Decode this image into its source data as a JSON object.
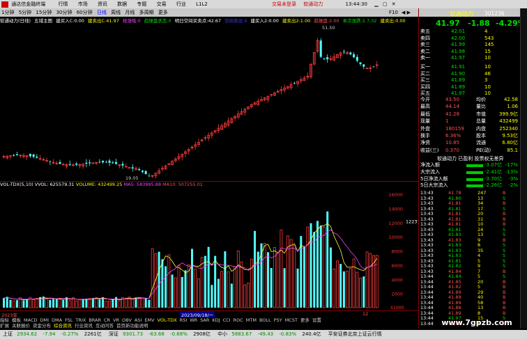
{
  "window": {
    "title": "通达信金融终端"
  },
  "menu": [
    "行情",
    "市场",
    "资讯",
    "数据",
    "专题",
    "交易",
    "行业",
    "L1L2"
  ],
  "menu_right": {
    "promo": "交易未登录",
    "stock": "软通动力",
    "time": "13:44:30"
  },
  "toolbar": {
    "timeframes": [
      "1分钟",
      "5分钟",
      "15分钟",
      "30分钟",
      "60分钟",
      "日线",
      "周线",
      "月线",
      "多周期",
      "更多"
    ],
    "active": "日线"
  },
  "chartinfo": {
    "name": "软通动力(日线)",
    "mode": "五域主图",
    "b1": "建买入C:0.00",
    "b2": "建卖出C:41.97",
    "b3": "抢涨吸:0",
    "b4": "趋操盘状态:0",
    "b5": "明日空间买卖点:42.67",
    "b6": "空间卖出:0",
    "b7": "建买入2:0.00",
    "b8": "建卖出2:1.00",
    "b9": "趋操盘:2.00",
    "b10": "本次涨跌:2.7.32",
    "b11": "建卖出:0.00"
  },
  "main_chart": {
    "price_axis": [
      "50.00",
      "47.50",
      "45.00",
      "42.50",
      "40.00",
      "37.50",
      "35.00",
      "32.50",
      "30.00",
      "27.50",
      "25.00",
      "22.50"
    ],
    "high_label": "51.50",
    "low_label": "19.05"
  },
  "volume_chart": {
    "indicator": "VOL-TDX(5,10)",
    "vvol": "VVOL: 625579.31",
    "volume": "VOLUME: 432499.25",
    "ma5": "MA5: 583995.88",
    "ma10": "MA10: 507255.01",
    "axis": [
      "16000",
      "14000",
      "12000",
      "10000",
      "8000",
      "6000",
      "4000",
      "2000"
    ],
    "marker": "12231",
    "xunit": "X1000"
  },
  "xaxis": {
    "left": "2023年",
    "date": "2023/09/18/一",
    "month": "12"
  },
  "quote": {
    "name": "软通动力",
    "code": "301236",
    "price": "41.97",
    "change": "-1.88",
    "pct": "-4.29%",
    "asks": [
      {
        "l": "卖五",
        "p": "42.01",
        "v": "4"
      },
      {
        "l": "卖四",
        "p": "42.00",
        "v": "543"
      },
      {
        "l": "卖三",
        "p": "41.99",
        "v": "145"
      },
      {
        "l": "卖二",
        "p": "41.98",
        "v": "15"
      },
      {
        "l": "卖一",
        "p": "41.97",
        "v": "10"
      }
    ],
    "bids": [
      {
        "l": "买一",
        "p": "41.91",
        "v": "10"
      },
      {
        "l": "买二",
        "p": "41.90",
        "v": "46"
      },
      {
        "l": "买三",
        "p": "41.89",
        "v": "3"
      },
      {
        "l": "买四",
        "p": "41.89",
        "v": "10"
      },
      {
        "l": "买五",
        "p": "41.97",
        "v": "10"
      }
    ],
    "stats": [
      {
        "a": "今开",
        "b": "43.50",
        "c": "均价",
        "d": "42.58"
      },
      {
        "a": "最高",
        "b": "44.14",
        "c": "量比",
        "d": "1.06"
      },
      {
        "a": "最低",
        "b": "41.28",
        "c": "市值",
        "d": "399.9亿"
      },
      {
        "a": "现量",
        "b": "1",
        "c": "总量",
        "d": "432499"
      },
      {
        "a": "外盘",
        "b": "180159",
        "c": "内盘",
        "d": "252340"
      },
      {
        "a": "换手",
        "b": "6.36%",
        "c": "股本",
        "d": "9.53亿"
      },
      {
        "a": "净资",
        "b": "10.85",
        "c": "流通",
        "d": "6.80亿"
      },
      {
        "a": "收益(三)",
        "b": "0.370",
        "c": "PE(动)",
        "d": "85.1"
      }
    ],
    "fundtitle": "软通动力 已盈利 投票权无差异",
    "funds": [
      {
        "n": "净流入额",
        "v": "-3.07亿",
        "p": "-17%"
      },
      {
        "n": "大宗流入",
        "v": "-2.41亿",
        "p": "-13%"
      },
      {
        "n": "5日净流入额",
        "v": "-3.70亿",
        "p": "-3%"
      },
      {
        "n": "5日大宗流入",
        "v": "-2.26亿",
        "p": "-2%"
      }
    ],
    "ticks": [
      [
        "13:43",
        "41.78",
        "247",
        "B"
      ],
      [
        "13:43",
        "41.80",
        "13",
        "S"
      ],
      [
        "13:43",
        "41.81",
        "34",
        "B"
      ],
      [
        "13:43",
        "41.81",
        "17",
        "S"
      ],
      [
        "13:43",
        "41.81",
        "20",
        "B"
      ],
      [
        "13:43",
        "41.81",
        "31",
        "B"
      ],
      [
        "13:43",
        "41.81",
        "10",
        "B"
      ],
      [
        "13:43",
        "41.81",
        "24",
        "S"
      ],
      [
        "13:43",
        "41.83",
        "13",
        "S"
      ],
      [
        "13:43",
        "41.83",
        "9",
        "B"
      ],
      [
        "13:43",
        "41.83",
        "8",
        "S"
      ],
      [
        "13:43",
        "41.83",
        "35",
        "S"
      ],
      [
        "13:43",
        "41.83",
        "4",
        "S"
      ],
      [
        "13:43",
        "41.81",
        "5",
        "S"
      ],
      [
        "13:43",
        "41.82",
        "9",
        "S"
      ],
      [
        "13:43",
        "41.84",
        "7",
        "B"
      ],
      [
        "13:44",
        "41.84",
        "5",
        "S"
      ],
      [
        "13:44",
        "41.85",
        "20",
        "B"
      ],
      [
        "13:44",
        "41.82",
        "5",
        "B"
      ],
      [
        "13:44",
        "41.89",
        "29",
        "B"
      ],
      [
        "13:44",
        "41.89",
        "40",
        "B"
      ],
      [
        "13:44",
        "41.89",
        "58",
        "B"
      ],
      [
        "13:44",
        "41.88",
        "13",
        "B"
      ],
      [
        "13:44",
        "41.89",
        "8",
        "B"
      ],
      [
        "13:44",
        "41.97",
        "15",
        "S"
      ],
      [
        "13:44",
        "41.97",
        "5",
        "B"
      ]
    ]
  },
  "tabs_row1": [
    "指标",
    "模板",
    "MACD",
    "DMI",
    "DMA",
    "FSL",
    "TRIX",
    "BRAR",
    "CR",
    "VR",
    "OBV",
    "ASI",
    "EMV",
    "VOL-TDX",
    "RSI",
    "WR",
    "SAR",
    "KDJ",
    "CCI",
    "ROC",
    "MTM",
    "BOLL",
    "PSY",
    "MCST",
    "更多",
    "设置"
  ],
  "tabs_row2": [
    "扩展",
    "关联报价",
    "资金分布",
    "综合资讯",
    "行业资讯",
    "互动问答",
    "首页新功能说明"
  ],
  "status": {
    "sh": "上证",
    "sh_v": "2934.62",
    "sh_c": "-7.94",
    "sh_p": "-0.27%",
    "sh_a": "2261亿",
    "sz": "深证",
    "sz_v": "9301.73",
    "sz_c": "-63.68",
    "sz_p": "-0.68%",
    "sz_a": "2908亿",
    "zx": "中小",
    "zx_v": "5883.67",
    "zx_c": "-49.43",
    "zx_p": "-0.83%",
    "zx_a": "240.4亿",
    "info": "平安证券北京上证云行情"
  },
  "watermark": "www.7gpzb.com"
}
